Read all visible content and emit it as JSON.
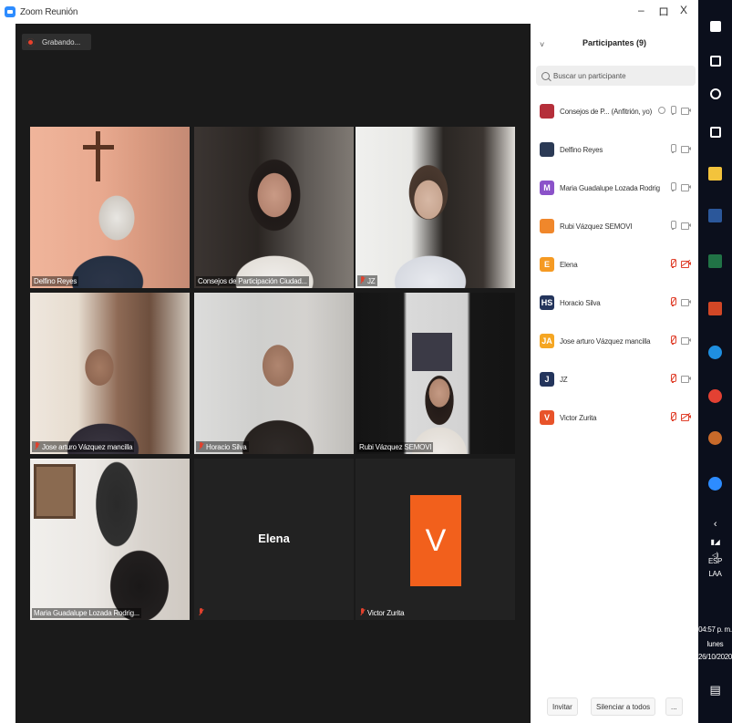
{
  "window": {
    "title": "Zoom Reunión",
    "controls": {
      "minimize": "–",
      "maximize": "ロ",
      "close": "X"
    }
  },
  "recording": {
    "label": "Grabando..."
  },
  "tiles": [
    {
      "name": "Delfino Reyes",
      "muted": false,
      "video": true
    },
    {
      "name": "Consejos de Participación Ciudad...",
      "muted": false,
      "video": true
    },
    {
      "name": "JZ",
      "muted": true,
      "video": true
    },
    {
      "name": "Jose arturo Vázquez mancilla",
      "muted": true,
      "video": true
    },
    {
      "name": "Horacio Silva",
      "muted": true,
      "video": true
    },
    {
      "name": "Rubi Vázquez SEMOVI",
      "muted": false,
      "video": true
    },
    {
      "name": "Maria Guadalupe Lozada Rodrig...",
      "muted": false,
      "video": true,
      "active": true
    },
    {
      "name": "Elena",
      "muted": true,
      "video": false
    },
    {
      "name": "Victor Zurita",
      "muted": true,
      "video": false,
      "avatar_letter": "V"
    }
  ],
  "panel": {
    "collapse_icon": "˅",
    "title": "Participantes (9)",
    "search_placeholder": "Buscar un participante",
    "participants": [
      {
        "name": "Consejos de P... (Anfitrión, yo)",
        "avatar": "",
        "avatar_color": "#b52f3a",
        "mic_muted": false,
        "cam_off": false,
        "sharing": true
      },
      {
        "name": "Delfino Reyes",
        "avatar": "",
        "avatar_color": "#2b3a55",
        "mic_muted": false,
        "cam_off": false
      },
      {
        "name": "Maria Guadalupe Lozada Rodrig...",
        "avatar": "M",
        "avatar_color": "#8b52c9",
        "mic_muted": false,
        "cam_off": false
      },
      {
        "name": "Rubi Vázquez SEMOVI",
        "avatar": "",
        "avatar_color": "#f0872b",
        "mic_muted": false,
        "cam_off": false
      },
      {
        "name": "Elena",
        "avatar": "E",
        "avatar_color": "#f59a23",
        "mic_muted": true,
        "cam_off": true
      },
      {
        "name": "Horacio Silva",
        "avatar": "HS",
        "avatar_color": "#24355c",
        "mic_muted": true,
        "cam_off": false
      },
      {
        "name": "Jose arturo Vázquez mancilla",
        "avatar": "JA",
        "avatar_color": "#f5a623",
        "mic_muted": true,
        "cam_off": false
      },
      {
        "name": "JZ",
        "avatar": "J",
        "avatar_color": "#24355c",
        "mic_muted": true,
        "cam_off": false
      },
      {
        "name": "Victor Zurita",
        "avatar": "V",
        "avatar_color": "#e8532a",
        "mic_muted": true,
        "cam_off": true
      }
    ],
    "footer": {
      "invite": "Invitar",
      "mute_all": "Silenciar a todos",
      "more": "..."
    }
  },
  "taskbar": {
    "language": "ESP",
    "layout": "LAA",
    "time": "04:57 p. m.",
    "day": "lunes",
    "date": "26/10/2020",
    "icons": [
      "windows-icon",
      "search-icon",
      "cortana-icon",
      "task-view-icon",
      "file-explorer-icon",
      "word-icon",
      "excel-icon",
      "powerpoint-icon",
      "edge-icon",
      "chrome-icon",
      "chrome-alt-icon",
      "zoom-icon"
    ]
  }
}
